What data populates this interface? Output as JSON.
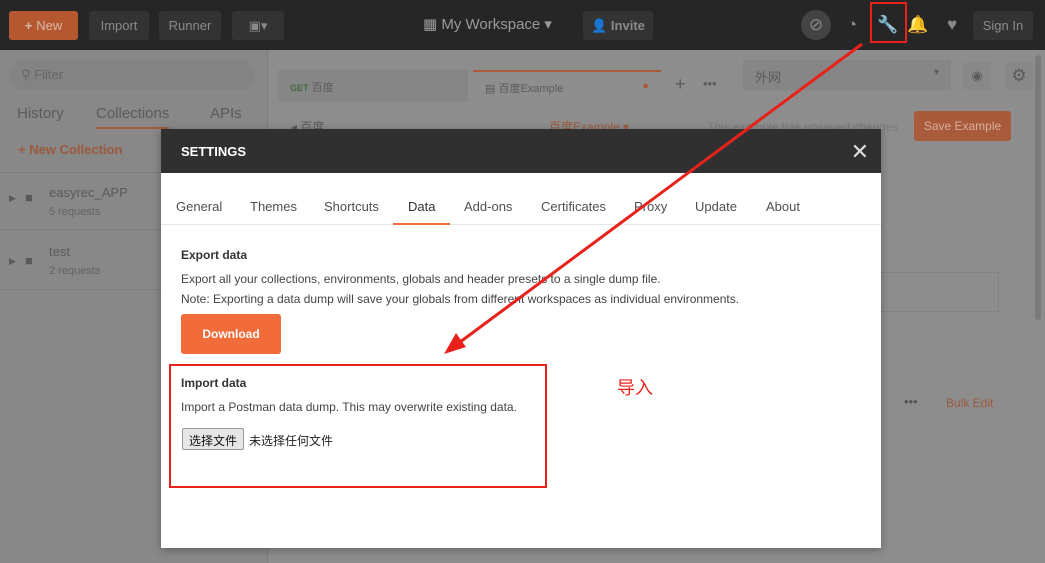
{
  "topbar": {
    "new_label": "New",
    "import_label": "Import",
    "runner_label": "Runner",
    "workspace_label": "My Workspace",
    "invite_label": "Invite",
    "signin_label": "Sign In"
  },
  "sidebar": {
    "filter_placeholder": "Filter",
    "tabs": [
      "History",
      "Collections",
      "APIs"
    ],
    "new_collection": "New Collection",
    "collections": [
      {
        "name": "easyrec_APP",
        "count": "5 requests"
      },
      {
        "name": "test",
        "count": "2 requests"
      }
    ]
  },
  "main": {
    "tabs": [
      {
        "method": "GET",
        "name": "百度"
      },
      {
        "name": "百度Example"
      }
    ],
    "environment": "外网",
    "breadcrumb_parent": "百度",
    "breadcrumb_example": "百度Example",
    "unsaved": "This example has unsaved changes",
    "save_example": "Save Example",
    "bulk_edit": "Bulk Edit"
  },
  "settings": {
    "title": "SETTINGS",
    "tabs": [
      "General",
      "Themes",
      "Shortcuts",
      "Data",
      "Add-ons",
      "Certificates",
      "Proxy",
      "Update",
      "About"
    ],
    "export_title": "Export data",
    "export_desc": "Export all your collections, environments, globals and header presets to a single dump file.",
    "export_note": "Note: Exporting a data dump will save your globals from different workspaces as individual environments.",
    "download_label": "Download",
    "import_title": "Import data",
    "import_desc": "Import a Postman data dump. This may overwrite existing data.",
    "choose_file": "选择文件",
    "no_file": "未选择任何文件"
  },
  "annotation": {
    "label": "导入",
    "color": "#e8221b"
  }
}
